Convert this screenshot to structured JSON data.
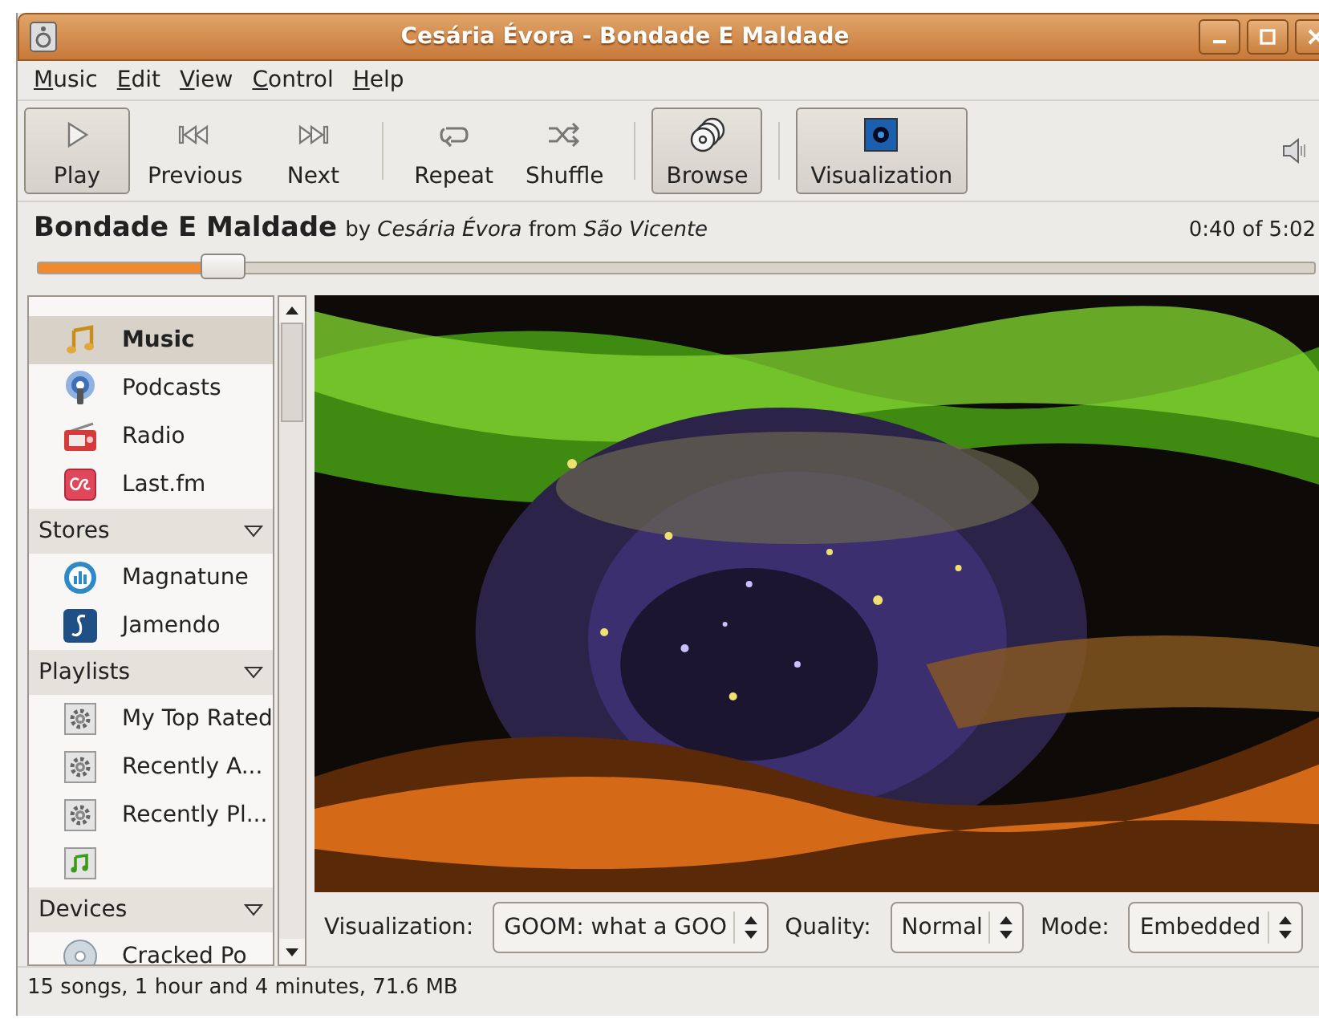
{
  "window": {
    "title": "Cesária Évora - Bondade E Maldade"
  },
  "menu": [
    "Music",
    "Edit",
    "View",
    "Control",
    "Help"
  ],
  "toolbar": [
    {
      "kind": "play",
      "label": "Play",
      "active": true
    },
    {
      "kind": "previous",
      "label": "Previous",
      "active": false
    },
    {
      "kind": "next",
      "label": "Next",
      "active": false
    },
    {
      "kind": "separator"
    },
    {
      "kind": "repeat",
      "label": "Repeat",
      "active": false
    },
    {
      "kind": "shuffle",
      "label": "Shuffle",
      "active": false
    },
    {
      "kind": "separator"
    },
    {
      "kind": "browse",
      "label": "Browse",
      "active": true
    },
    {
      "kind": "separator"
    },
    {
      "kind": "visualization",
      "label": "Visualization",
      "active": true
    }
  ],
  "now_playing": {
    "title": "Bondade E Maldade",
    "details": "by *Cesária Évora* from *São Vicente*",
    "time": "0:40 of 5:02",
    "level": 0.145
  },
  "sidebar": {
    "groups": [
      {
        "items": [
          {
            "kind": "music",
            "label": "Music",
            "selected": true
          },
          {
            "kind": "podcast",
            "label": "Podcasts",
            "selected": false
          },
          {
            "kind": "radio",
            "label": "Radio",
            "selected": false
          },
          {
            "kind": "lastfm",
            "label": "Last.fm",
            "selected": false
          }
        ]
      },
      {
        "title": "Stores",
        "expanded": true,
        "items": [
          {
            "kind": "magnatune",
            "label": "Magnatune",
            "selected": false
          },
          {
            "kind": "jamendo",
            "label": "Jamendo",
            "selected": false
          }
        ]
      },
      {
        "title": "Playlists",
        "expanded": true,
        "items": [
          {
            "kind": "smart",
            "label": "My Top Rated",
            "selected": false
          },
          {
            "kind": "smart",
            "label": "Recently A...",
            "selected": false
          },
          {
            "kind": "smart",
            "label": "Recently Pl...",
            "selected": false
          },
          {
            "kind": "static",
            "selected": false
          }
        ]
      },
      {
        "title": "Devices",
        "expanded": true,
        "items": [
          {
            "kind": "device",
            "label": "Cracked Po",
            "selected": false
          }
        ]
      }
    ]
  },
  "visualization": {
    "kind": "picture",
    "controls": [
      {
        "label": "Visualization:",
        "value": "GOOM: what a GOO"
      },
      {
        "label": "Quality:",
        "value": "Normal"
      },
      {
        "label": "Mode:",
        "value": "Embedded"
      }
    ]
  },
  "status_bar": "15 songs, 1 hour and 4 minutes, 71.6 MB"
}
